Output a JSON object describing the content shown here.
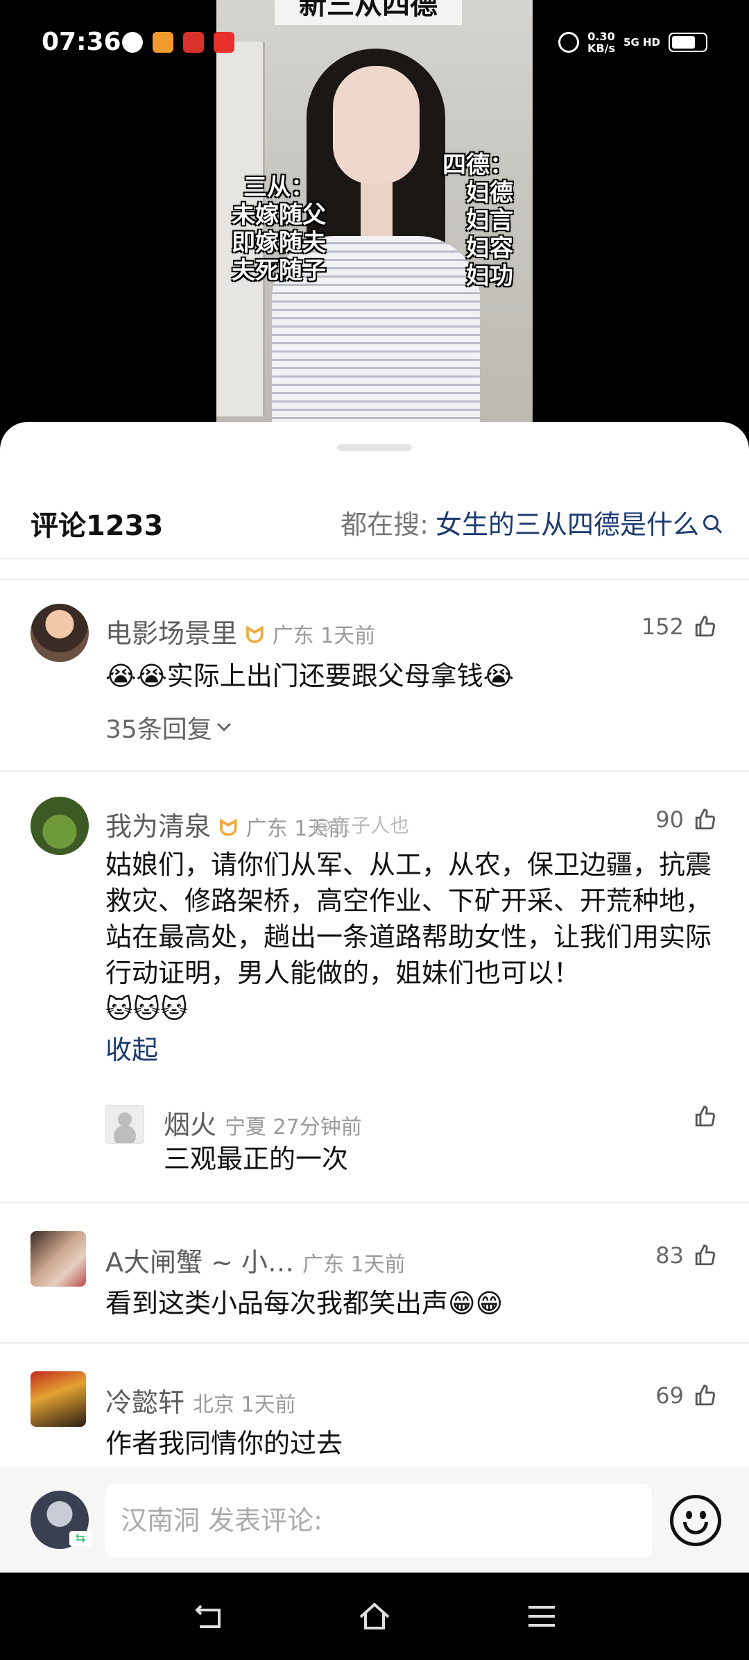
{
  "status_bar": {
    "time": "07:36",
    "net_speed_value": "0.30",
    "net_speed_unit": "KB/s",
    "network": "5G HD",
    "battery_level": 0.75
  },
  "video": {
    "title_text": "新三从四德",
    "caption_left": [
      "三从：",
      "未嫁随父",
      "即嫁随夫",
      "夫死随子"
    ],
    "caption_right": [
      "四德：",
      "妇德",
      "妇言",
      "妇容",
      "妇功"
    ]
  },
  "comments_header": {
    "label": "评论1233",
    "search_prefix": "都在搜:",
    "search_query": "女生的三从四德是什么"
  },
  "comments": [
    {
      "username": "电影场景里",
      "location_time": "广东 1天前",
      "likes": "152",
      "text": "😭😭实际上出门还要跟父母拿钱😭",
      "replies_label": "35条回复"
    },
    {
      "username": "我为清泉",
      "location_time": "广东 1天前",
      "likes": "90",
      "text": "姑娘们，请你们从军、从工，从农，保卫边疆，抗震救灾、修路架桥，高空作业、下矿开采、开荒种地，站在最高处，趟出一条道路帮助女性，让我们用实际行动证明，男人能做的，姐妹们也可以！",
      "emoji_line": "🐱🐱🐱",
      "collapse_label": "收起",
      "watermark": "@东子人也"
    },
    {
      "username": "A大闸蟹 ~ 小…",
      "location_time": "广东 1天前",
      "likes": "83",
      "text": "看到这类小品每次我都笑出声😁😁"
    },
    {
      "username": "冷懿轩",
      "location_time": "北京 1天前",
      "likes": "69",
      "text": "作者我同情你的过去"
    }
  ],
  "reply": {
    "username": "烟火",
    "location_time": "宁夏 27分钟前",
    "text": "三观最正的一次"
  },
  "input": {
    "placeholder": "汉南洞 发表评论:"
  },
  "icons": {
    "like": "thumb-up-icon",
    "emoji": "smiley-face-icon",
    "search": "search-icon",
    "nav": [
      "back-icon",
      "home-icon",
      "menu-icon"
    ]
  },
  "colors": {
    "link": "#1b3a70",
    "vip": "#f2a93b",
    "meta_gray": "#9a9a9a"
  }
}
